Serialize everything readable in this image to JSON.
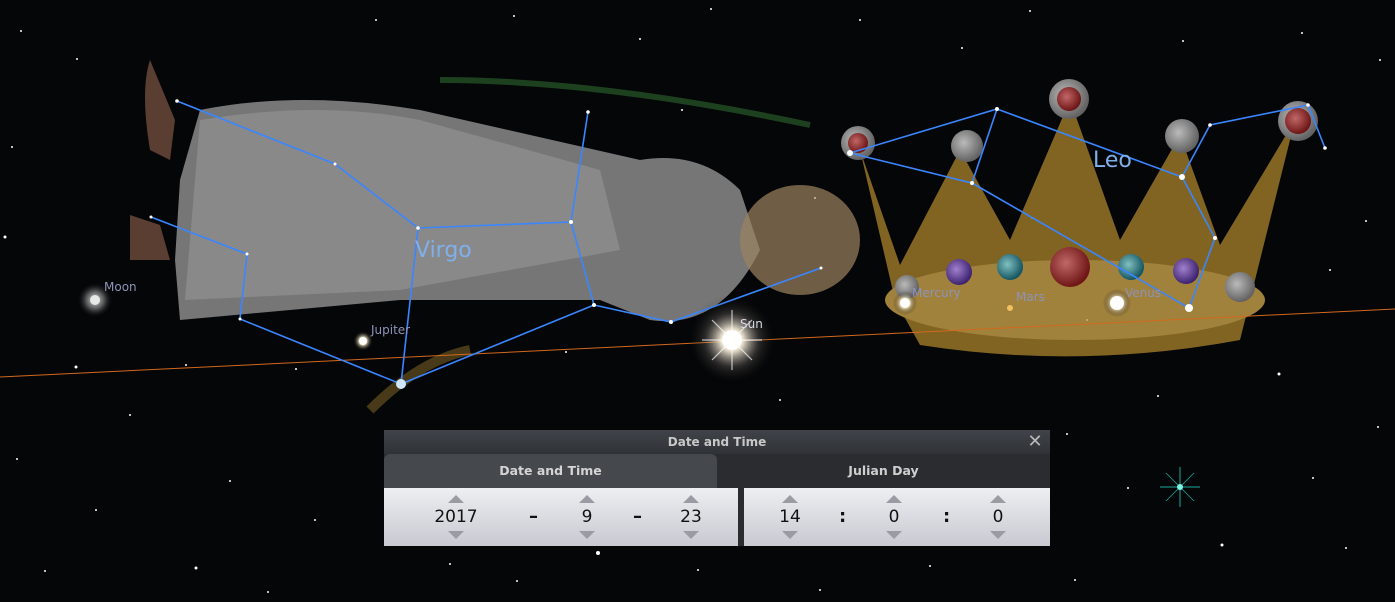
{
  "sky": {
    "constellations": [
      {
        "name": "Virgo"
      },
      {
        "name": "Leo"
      }
    ],
    "objects": {
      "moon": "Moon",
      "jupiter": "Jupiter",
      "sun": "Sun",
      "mercury": "Mercury",
      "mars": "Mars",
      "venus": "Venus"
    },
    "colors": {
      "constellation_line": "#3a86ff",
      "ecliptic": "#d2691e",
      "label": "#8d93b8"
    }
  },
  "dialog": {
    "title": "Date and Time",
    "close_icon": "close-icon",
    "tabs": [
      {
        "label": "Date and Time",
        "active": true
      },
      {
        "label": "Julian Day",
        "active": false
      }
    ],
    "date": {
      "year": "2017",
      "month": "9",
      "day": "23",
      "separator": "–"
    },
    "time": {
      "hour": "14",
      "minute": "0",
      "second": "0",
      "separator": ":"
    }
  }
}
